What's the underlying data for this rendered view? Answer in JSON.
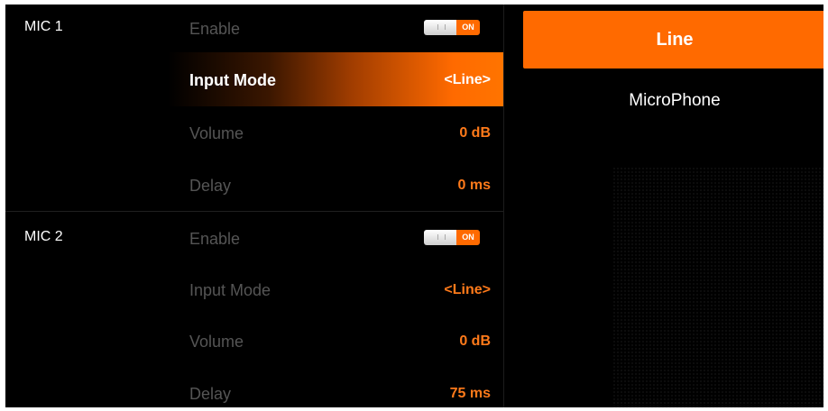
{
  "mic1": {
    "title": "MIC 1",
    "enable_label": "Enable",
    "enable_toggle": "ON",
    "input_mode_label": "Input Mode",
    "input_mode_value": "<Line>",
    "volume_label": "Volume",
    "volume_value": "0 dB",
    "delay_label": "Delay",
    "delay_value": "0 ms"
  },
  "mic2": {
    "title": "MIC 2",
    "enable_label": "Enable",
    "enable_toggle": "ON",
    "input_mode_label": "Input Mode",
    "input_mode_value": "<Line>",
    "volume_label": "Volume",
    "volume_value": "0 dB",
    "delay_label": "Delay",
    "delay_value": "75 ms"
  },
  "options": {
    "selected": "Line",
    "other": "MicroPhone"
  },
  "colors": {
    "accent": "#ff6a00",
    "value_text": "#ff7a1a",
    "background": "#000000",
    "inactive_label": "#555555"
  }
}
